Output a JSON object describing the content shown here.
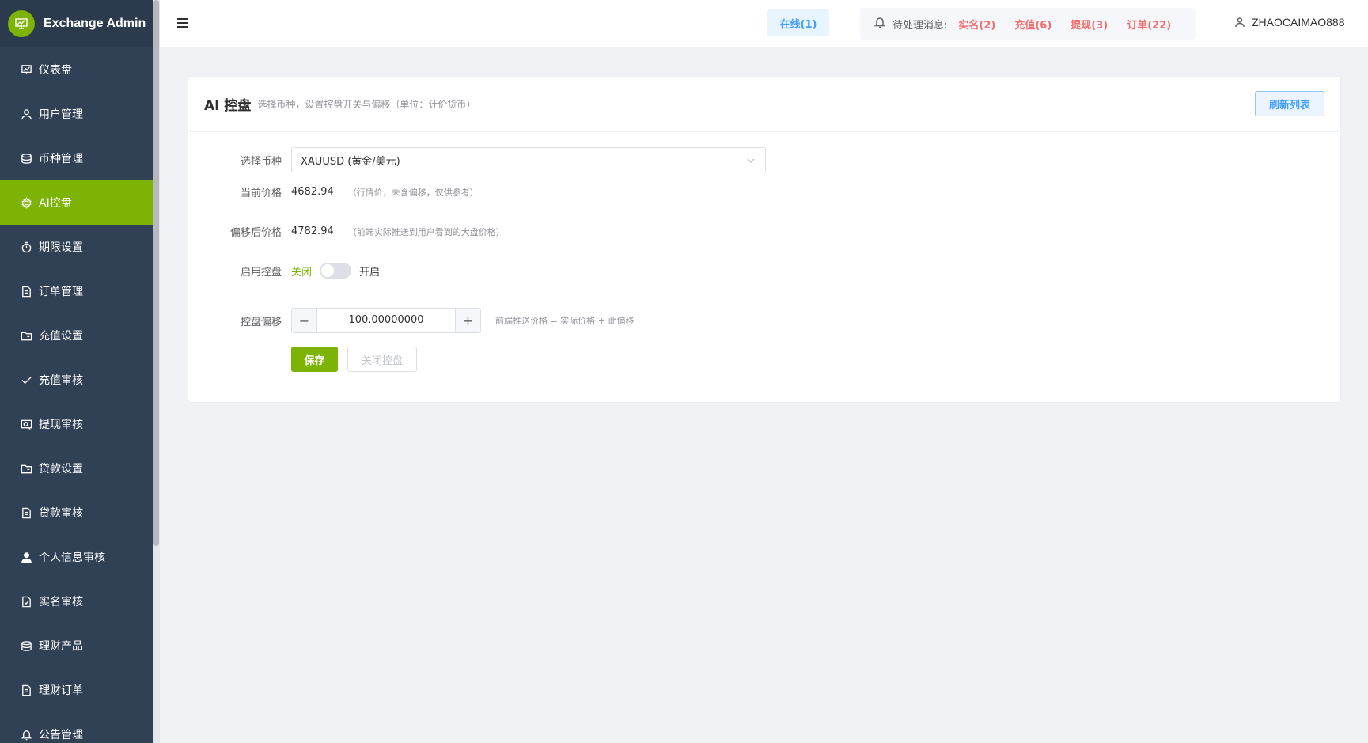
{
  "app": {
    "title": "Exchange Admin"
  },
  "sidebar": {
    "items": [
      {
        "label": "仪表盘",
        "icon": "dashboard-icon"
      },
      {
        "label": "用户管理",
        "icon": "user-icon"
      },
      {
        "label": "币种管理",
        "icon": "database-icon"
      },
      {
        "label": "AI控盘",
        "icon": "gear-icon",
        "active": true
      },
      {
        "label": "期限设置",
        "icon": "timer-icon"
      },
      {
        "label": "订单管理",
        "icon": "document-icon"
      },
      {
        "label": "充值设置",
        "icon": "folder-icon"
      },
      {
        "label": "充值审核",
        "icon": "check-icon"
      },
      {
        "label": "提现审核",
        "icon": "withdraw-icon"
      },
      {
        "label": "贷款设置",
        "icon": "folder-icon"
      },
      {
        "label": "贷款审核",
        "icon": "document-icon"
      },
      {
        "label": "个人信息审核",
        "icon": "person-icon"
      },
      {
        "label": "实名审核",
        "icon": "verify-icon"
      },
      {
        "label": "理财产品",
        "icon": "database-icon"
      },
      {
        "label": "理财订单",
        "icon": "document-icon"
      },
      {
        "label": "公告管理",
        "icon": "bell-icon"
      }
    ]
  },
  "header": {
    "online": "在线(1)",
    "notif_label": "待处理消息:",
    "notifs": [
      "实名(2)",
      "充值(6)",
      "提现(3)",
      "订单(22)"
    ],
    "username": "ZHAOCAIMAO888"
  },
  "card": {
    "title": "AI 控盘",
    "subtitle": "选择币种，设置控盘开关与偏移（单位：计价货币）",
    "refresh_label": "刷新列表"
  },
  "form": {
    "symbol_label": "选择币种",
    "symbol_value": "XAUUSD (黄金/美元)",
    "current_price_label": "当前价格",
    "current_price": "4682.94",
    "current_price_hint": "（行情价，未含偏移，仅供参考）",
    "offset_price_label": "偏移后价格",
    "offset_price": "4782.94",
    "offset_price_hint": "（前端实际推送到用户看到的大盘价格）",
    "enable_label": "启用控盘",
    "enable_off": "关闭",
    "enable_on": "开启",
    "offset_label": "控盘偏移",
    "offset_value": "100.00000000",
    "offset_hint": "前端推送价格 = 实际价格 + 此偏移",
    "save_label": "保存",
    "close_label": "关闭控盘"
  },
  "colors": {
    "accent": "#7cb305",
    "sidebar_bg": "#304156",
    "danger": "#f56c6c",
    "primary": "#409eff"
  }
}
